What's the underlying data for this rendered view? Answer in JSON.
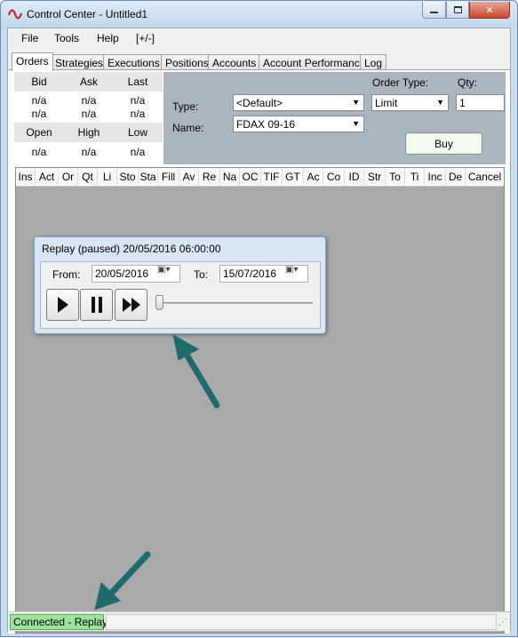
{
  "window": {
    "title": "Control Center - Untitled1",
    "minimize_label": "—",
    "maximize_label": "□",
    "close_label": "✕"
  },
  "menu": {
    "items": [
      "File",
      "Tools",
      "Help",
      "[+/-]"
    ]
  },
  "tabs": [
    "Orders",
    "Strategies",
    "Executions",
    "Positions",
    "Accounts",
    "Account Performance",
    "Log"
  ],
  "active_tab": "Orders",
  "quote": {
    "bid_label": "Bid",
    "ask_label": "Ask",
    "last_label": "Last",
    "bid": [
      "n/a",
      "n/a"
    ],
    "ask": [
      "n/a",
      "n/a"
    ],
    "last": [
      "n/a",
      "n/a"
    ],
    "open_label": "Open",
    "high_label": "High",
    "low_label": "Low",
    "open": "n/a",
    "high": "n/a",
    "low": "n/a"
  },
  "order_form": {
    "type_label": "Type:",
    "type_value": "<Default>",
    "name_label": "Name:",
    "name_value": "FDAX 09-16",
    "order_type_label": "Order Type:",
    "order_type_value": "Limit",
    "qty_label": "Qty:",
    "qty_value": "1",
    "buy_label": "Buy"
  },
  "grid_columns": [
    "Ins",
    "Act",
    "Or",
    "Qt",
    "Li",
    "Sto",
    "Sta",
    "Fill",
    "Av",
    "Re",
    "Na",
    "OC",
    "TIF",
    "GT",
    "Ac",
    "Co",
    "ID",
    "Str",
    "To",
    "Ti",
    "Inc",
    "De",
    "Cancel"
  ],
  "replay": {
    "title": "Replay (paused) 20/05/2016 06:00:00",
    "from_label": "From:",
    "from_value": "20/05/2016",
    "to_label": "To:",
    "to_value": "15/07/2016",
    "slider_position": 0
  },
  "status": {
    "connection": "Connected - Replay"
  },
  "colors": {
    "annotation_arrow": "#1f6b6b",
    "status_connected": "#9be59b",
    "buy_button": "#f3fbf0"
  }
}
